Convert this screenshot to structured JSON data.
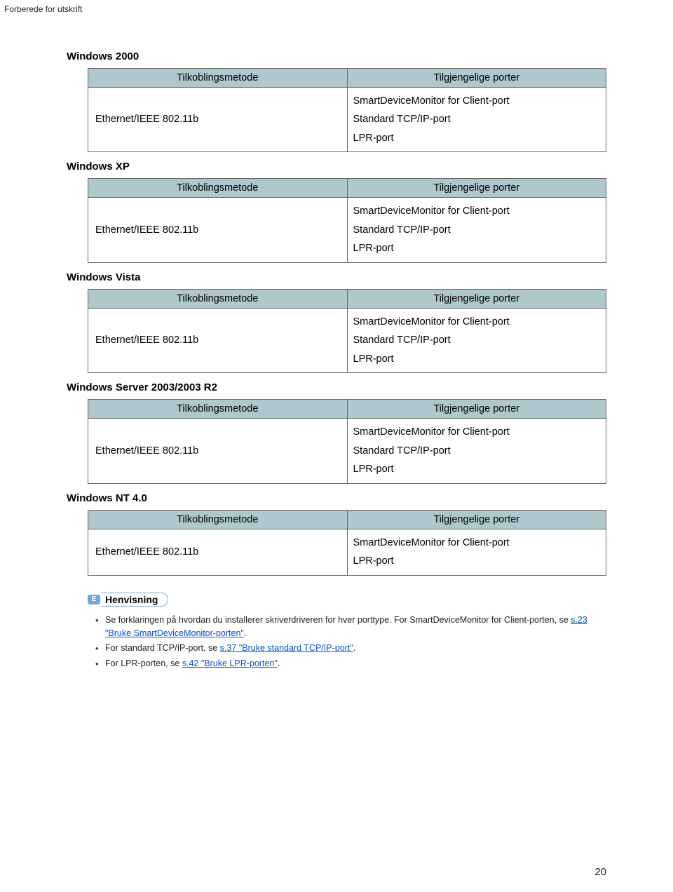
{
  "header_label": "Forberede for utskrift",
  "common": {
    "th_method": "Tilkoblingsmetode",
    "th_ports": "Tilgjengelige porter",
    "ethernet": "Ethernet/IEEE 802.11b",
    "smart": "SmartDeviceMonitor for Client-port",
    "tcpip": "Standard TCP/IP-port",
    "lpr": "LPR-port"
  },
  "sections": {
    "s1": "Windows 2000",
    "s2": "Windows XP",
    "s3": "Windows Vista",
    "s4": "Windows Server 2003/2003 R2",
    "s5": "Windows NT 4.0"
  },
  "reference": {
    "label": "Henvisning",
    "b1a": "Se forklaringen på hvordan du installerer skriverdriveren for hver porttype. For SmartDeviceMonitor for Client-porten, se ",
    "b1link": "s.23 \"Bruke SmartDeviceMonitor-porten\"",
    "b1z": ".",
    "b2a": "For standard TCP/IP-port, se ",
    "b2link": "s.37 \"Bruke standard TCP/IP-port\"",
    "b2z": ".",
    "b3a": "For LPR-porten, se ",
    "b3link": "s.42 \"Bruke LPR-porten\"",
    "b3z": "."
  },
  "page_number": "20"
}
